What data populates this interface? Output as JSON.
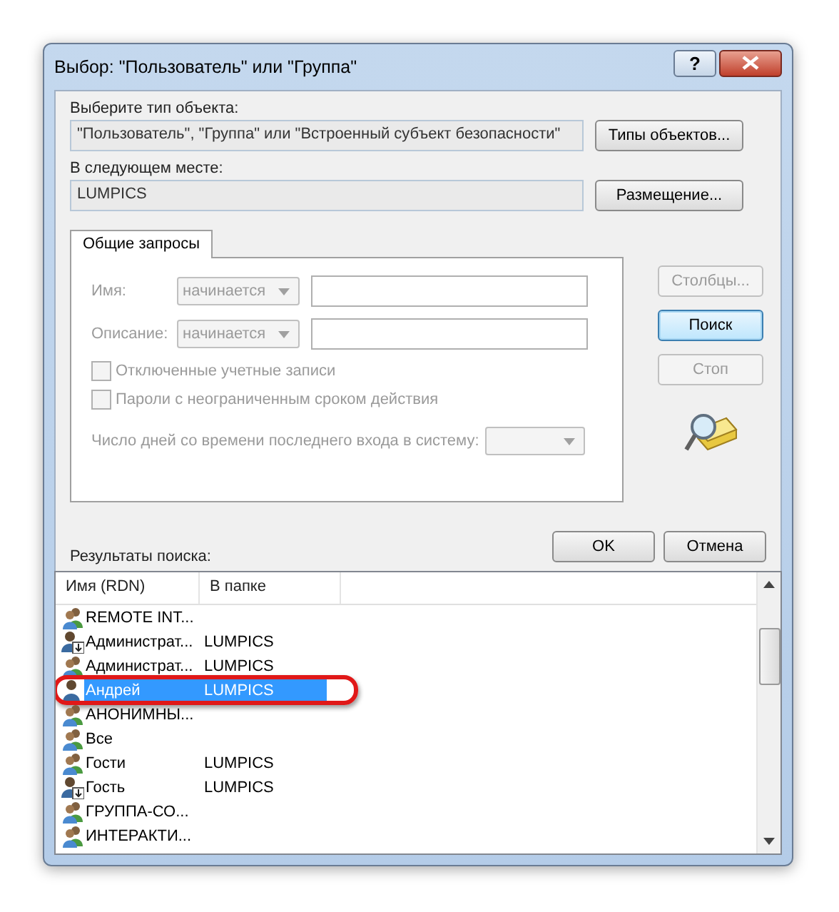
{
  "window": {
    "title": "Выбор: \"Пользователь\" или \"Группа\"",
    "help_button": "?"
  },
  "object_type": {
    "label": "Выберите тип объекта:",
    "value": "\"Пользователь\", \"Группа\" или \"Встроенный субъект безопасности\"",
    "button": "Типы объектов..."
  },
  "location": {
    "label": "В следующем месте:",
    "value": "LUMPICS",
    "button": "Размещение..."
  },
  "tabs": [
    {
      "label": "Общие запросы",
      "selected": true
    }
  ],
  "query_fields": [
    {
      "label": "Имя:",
      "operator": "начинается",
      "disabled": true
    },
    {
      "label": "Описание:",
      "operator": "начинается",
      "disabled": true
    }
  ],
  "checkboxes": [
    {
      "label": "Отключенные учетные записи",
      "checked": false,
      "disabled": true
    },
    {
      "label": "Пароли с неограниченным сроком действия",
      "checked": false,
      "disabled": true
    }
  ],
  "days_since_logon": {
    "label": "Число дней со времени последнего входа в систему:",
    "disabled": true
  },
  "side_buttons": [
    {
      "label": "Столбцы...",
      "disabled": true,
      "default": false
    },
    {
      "label": "Поиск",
      "disabled": false,
      "default": true
    },
    {
      "label": "Стоп",
      "disabled": true,
      "default": false
    }
  ],
  "dialog_buttons": [
    "OK",
    "Отмена"
  ],
  "results": {
    "label": "Результаты поиска:",
    "columns": [
      "Имя (RDN)",
      "В папке"
    ],
    "rows": [
      {
        "kind": "group",
        "name": "REMOTE INT...",
        "folder": "",
        "selected": false,
        "circled": false
      },
      {
        "kind": "local_user",
        "name": "Администрат...",
        "folder": "LUMPICS",
        "selected": false,
        "circled": false
      },
      {
        "kind": "group",
        "name": "Администрат...",
        "folder": "LUMPICS",
        "selected": false,
        "circled": false
      },
      {
        "kind": "user",
        "name": "Андрей",
        "folder": "LUMPICS",
        "selected": true,
        "circled": true
      },
      {
        "kind": "group",
        "name": "АНОНИМНЫ...",
        "folder": "",
        "selected": false,
        "circled": false
      },
      {
        "kind": "group",
        "name": "Все",
        "folder": "",
        "selected": false,
        "circled": false
      },
      {
        "kind": "group",
        "name": "Гости",
        "folder": "LUMPICS",
        "selected": false,
        "circled": false
      },
      {
        "kind": "local_user",
        "name": "Гость",
        "folder": "LUMPICS",
        "selected": false,
        "circled": false
      },
      {
        "kind": "group",
        "name": "ГРУППА-СО...",
        "folder": "",
        "selected": false,
        "circled": false
      },
      {
        "kind": "group",
        "name": "ИНТЕРАКТИ...",
        "folder": "",
        "selected": false,
        "circled": false
      }
    ]
  }
}
